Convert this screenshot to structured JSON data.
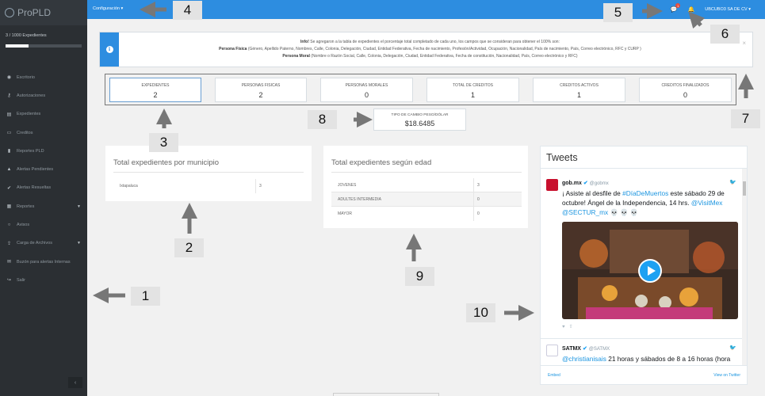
{
  "app": {
    "brand": "ProPLD"
  },
  "sidebar": {
    "expedientes_count": "3 / 1000 Expedientes",
    "expedientes_progress": 0.3,
    "items": [
      {
        "label": "Escritorio",
        "icon": "dashboard-icon"
      },
      {
        "label": "Autorizaciones",
        "icon": "key-icon"
      },
      {
        "label": "Expedientes",
        "icon": "book-icon"
      },
      {
        "label": "Creditos",
        "icon": "credit-card-icon"
      },
      {
        "label": "Reportes PLD",
        "icon": "file-icon"
      },
      {
        "label": "Alertas Pendientes",
        "icon": "warning-icon"
      },
      {
        "label": "Alertas Resueltas",
        "icon": "check-circle-icon"
      },
      {
        "label": "Reportes",
        "icon": "report-icon"
      },
      {
        "label": "Avisos",
        "icon": "comment-icon"
      },
      {
        "label": "Carga de Archivos",
        "icon": "upload-icon"
      },
      {
        "label": "Buzón para alertas Internas",
        "icon": "inbox-icon"
      },
      {
        "label": "Salir",
        "icon": "logout-icon"
      }
    ],
    "collapse": "‹"
  },
  "topbar": {
    "config": "Configuración ▾",
    "notif_badge": "1",
    "user": "UBCUBO3 SA DE CV ▾"
  },
  "info": {
    "title": "Info!",
    "intro": " Se agregaron a la tabla de expedientes el porcentaje total completado de cada uno, los campos que se consideran para obtener el 100% son:",
    "pf_label": "Persona Física",
    "pf_text": " (Género, Apellido Paterno, Nombres, Calle, Colonia, Delegación, Ciudad, Entidad Federativa, Fecha de nacimiento, Profesión/Actividad, Ocupación, Nacionalidad, País de nacimiento, País, Correo electrónico, RFC y CURP )",
    "pm_label": "Persona Moral",
    "pm_text": " (Nombre o Razón Social, Calle, Colonia, Delegación, Ciudad, Entidad Federativa, Fecha de constitución, Nacionalidad, País, Correo electrónico y RFC)",
    "close": "×"
  },
  "stats": [
    {
      "label": "EXPEDIENTES",
      "value": "2"
    },
    {
      "label": "PERSONAS FISICAS",
      "value": "2"
    },
    {
      "label": "PERSONAS MORALES",
      "value": "0"
    },
    {
      "label": "TOTAL DE CREDITOS",
      "value": "1"
    },
    {
      "label": "CREDITOS ACTIVOS",
      "value": "1"
    },
    {
      "label": "CREDITOS FINALIZADOS",
      "value": "0"
    }
  ],
  "tipo_cambio": {
    "label": "TIPO DE CAMBIO PESO/DÓLAR",
    "value": "$18.6485"
  },
  "municipio_panel": {
    "title": "Total expedientes por municipio",
    "rows": [
      {
        "name": "Ixtapaluca",
        "value": "3"
      }
    ]
  },
  "edad_panel": {
    "title": "Total expedientes según edad",
    "rows": [
      {
        "name": "JOVENES",
        "value": "3"
      },
      {
        "name": "ADULTES INTERMEDIA",
        "value": "0"
      },
      {
        "name": "MAYOR",
        "value": "0"
      }
    ]
  },
  "tweets": {
    "header": "Tweets",
    "items": [
      {
        "name": "gob.mx",
        "handle": "@gobmx",
        "text_before": "¡ Asiste al desfile de ",
        "hashtag": "#DíaDeMuertos",
        "text_after": " este sábado 29 de octubre! Ángel de la Independencia, 14 hrs. ",
        "mentions": "@VisitMex @SECTUR_mx",
        "emoji": " 💀 💀 💀"
      },
      {
        "name": "SATMX",
        "handle": "@SATMX",
        "mention": "@christianisais",
        "text": " 21 horas y sábados de 8 a 16 horas (hora centro), para que te indiquen los requerimientos"
      }
    ],
    "embed": "Embed",
    "view": "View on Twitter"
  },
  "annotations": [
    "1",
    "2",
    "3",
    "4",
    "5",
    "6",
    "7",
    "8",
    "9",
    "10"
  ]
}
